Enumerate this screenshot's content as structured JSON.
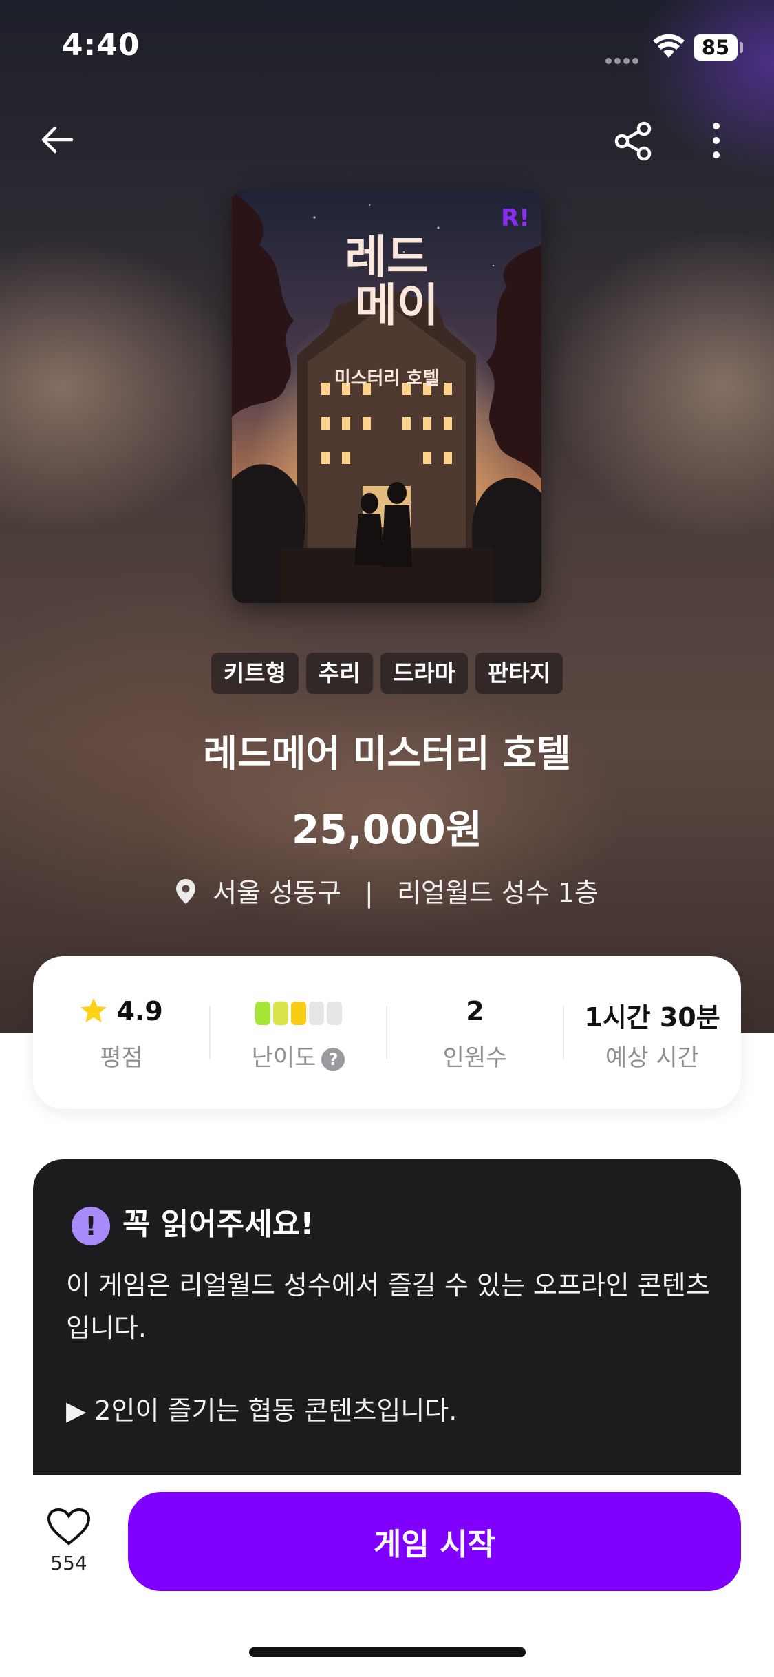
{
  "status_bar": {
    "time": "4:40",
    "battery": "85"
  },
  "header": {
    "back_icon": "arrow-left-icon",
    "share_icon": "share-icon",
    "more_icon": "more-vertical-icon"
  },
  "cover": {
    "title_line1": "레드",
    "title_line2": "메이",
    "subtitle": "미스터리 호텔",
    "logo": "R!"
  },
  "game": {
    "tags": [
      "키트형",
      "추리",
      "드라마",
      "판타지"
    ],
    "title": "레드메어 미스터리 호텔",
    "price": "25,000원",
    "location": {
      "region": "서울 성동구",
      "place": "리얼월드 성수 1층"
    }
  },
  "stats": {
    "rating": {
      "value": "4.9",
      "label": "평점"
    },
    "difficulty": {
      "level": 3,
      "max": 5,
      "label": "난이도",
      "help": "?"
    },
    "players": {
      "value": "2",
      "label": "인원수"
    },
    "duration": {
      "value": "1시간 30분",
      "label": "예상 시간"
    }
  },
  "notice": {
    "icon": "!",
    "title": "꼭 읽어주세요!",
    "paragraphs": [
      "이 게임은 리얼월드 성수에서 즐길 수 있는 오프라인 콘텐츠입니다.",
      "▶ 2인이 즐기는 협동 콘텐츠입니다."
    ]
  },
  "bottom_bar": {
    "like_count": "554",
    "start_label": "게임 시작"
  },
  "colors": {
    "accent": "#8000ff",
    "difficulty_filled": [
      "#a3e635",
      "#d9e44a",
      "#facc15"
    ],
    "difficulty_empty": "#e6e6e6",
    "star": "#fcd116",
    "notice_badge": "#a78bfa"
  }
}
